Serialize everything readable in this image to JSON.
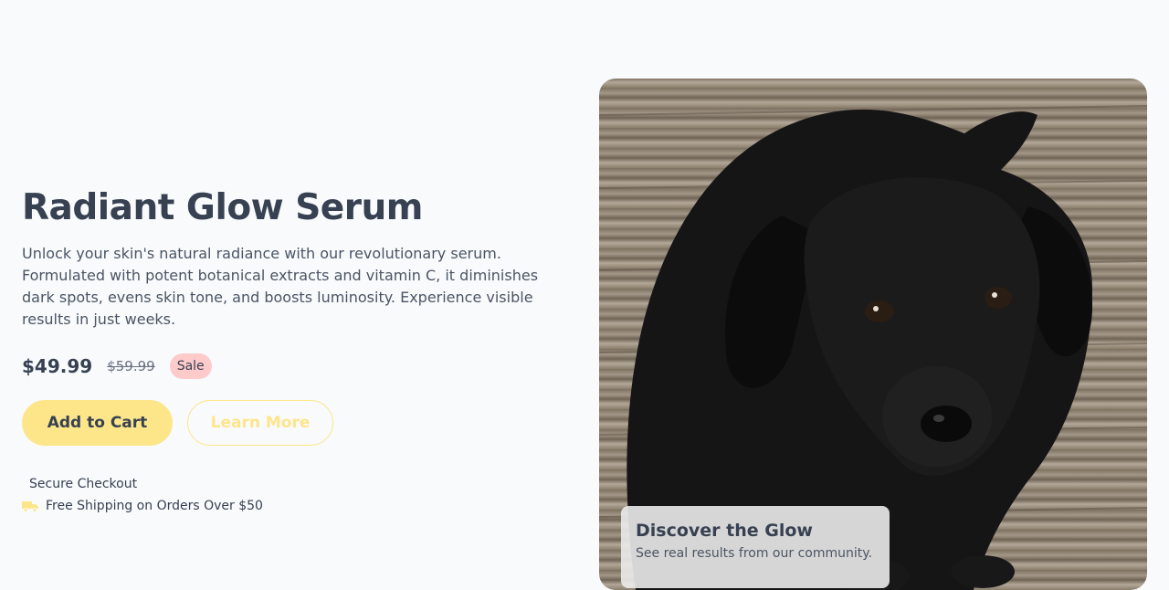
{
  "product": {
    "title": "Radiant Glow Serum",
    "description": "Unlock your skin's natural radiance with our revolutionary serum. Formulated with potent botanical extracts and vitamin C, it diminishes dark spots, evens skin tone, and boosts luminosity. Experience visible results in just weeks.",
    "price": "$49.99",
    "old_price": "$59.99",
    "badge": "Sale"
  },
  "actions": {
    "add_to_cart": "Add to Cart",
    "learn_more": "Learn More"
  },
  "features": {
    "secure": "Secure Checkout",
    "shipping": "Free Shipping on Orders Over $50"
  },
  "hero": {
    "caption_title": "Discover the Glow",
    "caption_text": "See real results from our community."
  },
  "colors": {
    "accent": "#fde68a",
    "sale_badge": "#fecaca",
    "text": "#374151",
    "background": "#f8fafc"
  },
  "icons": {
    "shipping": "truck-icon"
  }
}
